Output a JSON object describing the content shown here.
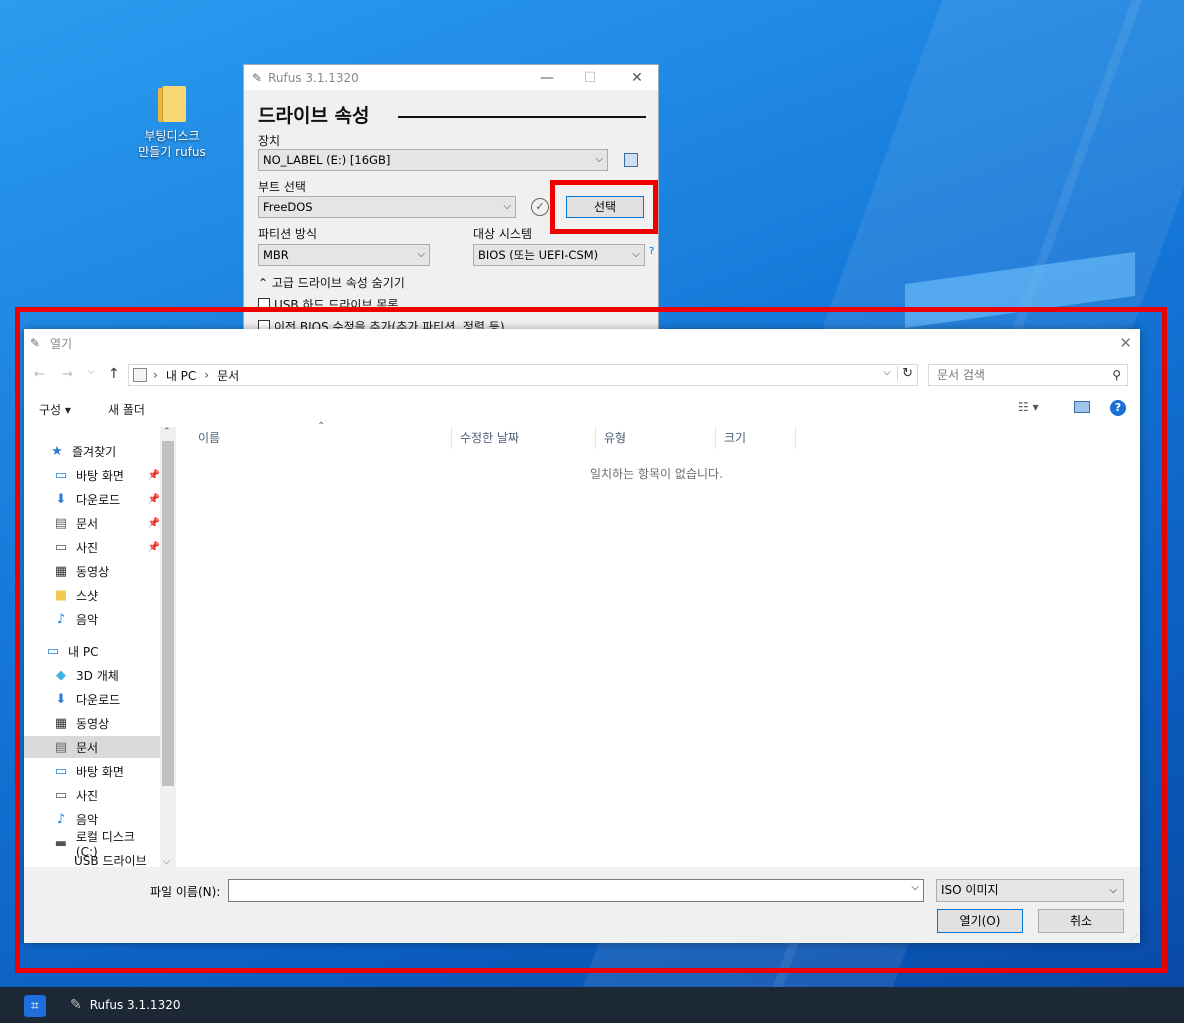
{
  "desktop": {
    "icon_label_line1": "부팅디스크",
    "icon_label_line2": "만들기 rufus"
  },
  "rufus": {
    "title": "Rufus 3.1.1320",
    "section_drive": "드라이브 속성",
    "device_label": "장치",
    "device_value": "NO_LABEL (E:) [16GB]",
    "boot_label": "부트 선택",
    "boot_value": "FreeDOS",
    "select_button": "선택",
    "partition_label": "파티션 방식",
    "partition_value": "MBR",
    "target_label": "대상 시스템",
    "target_value": "BIOS (또는 UEFI-CSM)",
    "help": "?",
    "advanced_toggle": "고급 드라이브 속성 숨기기",
    "opt_usb_hdd": "USB 하드 드라이브 목록",
    "opt_bios_fix": "이전 BIOS 수정을 추가(추가 파티션, 정렬 등)"
  },
  "dialog": {
    "title": "열기",
    "breadcrumb": [
      "내 PC",
      "문서"
    ],
    "search_placeholder": "문서 검색",
    "organize": "구성 ▾",
    "new_folder": "새 폴더",
    "nav": {
      "quick_access": "즐겨찾기",
      "qa_items": [
        "바탕 화면",
        "다운로드",
        "문서",
        "사진",
        "동영상",
        "스샷",
        "음악"
      ],
      "this_pc": "내 PC",
      "pc_items": [
        "3D 개체",
        "다운로드",
        "동영상",
        "문서",
        "바탕 화면",
        "사진",
        "음악",
        "로컬 디스크 (C:)",
        "USB 드라이브 (E"
      ]
    },
    "columns": [
      "이름",
      "수정한 날짜",
      "유형",
      "크기"
    ],
    "empty_message": "일치하는 항목이 없습니다.",
    "filename_label": "파일 이름(N):",
    "filename_value": "",
    "filetype_value": "ISO 이미지",
    "open_button": "열기(O)",
    "cancel_button": "취소"
  },
  "taskbar": {
    "app_label": "Rufus 3.1.1320"
  },
  "colors": {
    "highlight": "#ee0000",
    "accent": "#0078d7"
  }
}
